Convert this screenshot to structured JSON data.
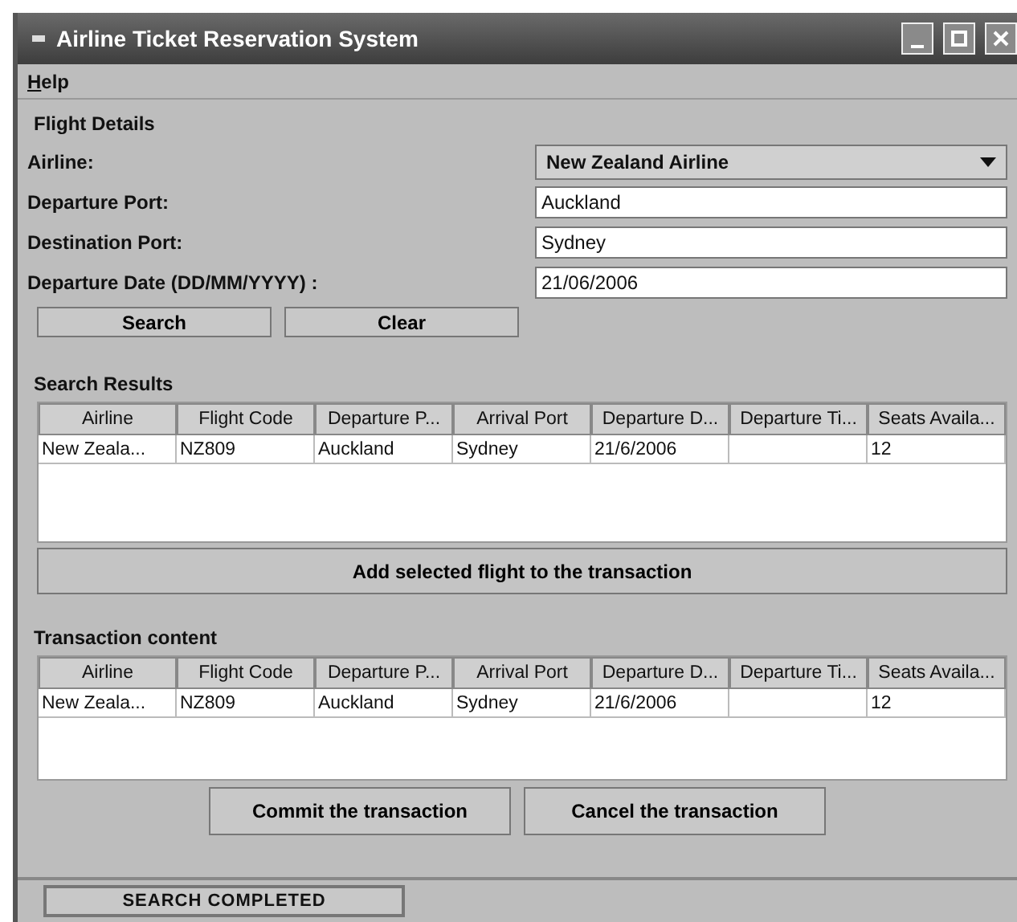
{
  "window": {
    "title": "Airline Ticket Reservation System"
  },
  "menu": [
    {
      "label": "Help"
    }
  ],
  "flight_details": {
    "title": "Flight Details",
    "fields": [
      {
        "kind": "dropdown",
        "label": "Airline:",
        "value": "New Zealand Airline"
      },
      {
        "kind": "text",
        "label": "Departure Port:",
        "value": "Auckland"
      },
      {
        "kind": "text",
        "label": "Destination Port:",
        "value": "Sydney"
      },
      {
        "kind": "text",
        "label": "Departure Date (DD/MM/YYYY) :",
        "value": "21/06/2006"
      }
    ],
    "buttons": [
      "Search",
      "Clear"
    ]
  },
  "search_results": {
    "title": "Search Results",
    "columns": [
      "Airline",
      "Flight Code",
      "Departure P...",
      "Arrival Port",
      "Departure D...",
      "Departure Ti...",
      "Seats Availa..."
    ],
    "rows": [
      [
        "New Zeala...",
        "NZ809",
        "Auckland",
        "Sydney",
        "21/6/2006",
        "",
        "12"
      ]
    ],
    "button": "Add selected flight to the transaction"
  },
  "transaction": {
    "title": "Transaction content",
    "columns": [
      "Airline",
      "Flight Code",
      "Departure P...",
      "Arrival Port",
      "Departure D...",
      "Departure Ti...",
      "Seats Availa..."
    ],
    "rows": [
      [
        "New Zeala...",
        "NZ809",
        "Auckland",
        "Sydney",
        "21/6/2006",
        "",
        "12"
      ]
    ],
    "buttons": [
      "Commit the transaction",
      "Cancel the transaction"
    ]
  },
  "status_bar": "SEARCH COMPLETED"
}
